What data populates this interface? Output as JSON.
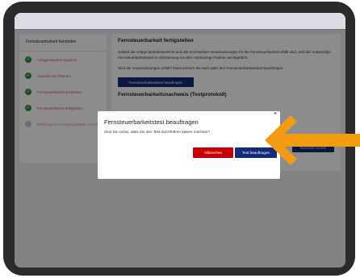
{
  "sidebar": {
    "title": "Fernsteuerbarkeit herstellen",
    "items": [
      {
        "label": "Anlagenstandort angeben",
        "status": "done"
      },
      {
        "label": "Auswahl des Partners",
        "status": "done"
      },
      {
        "label": "Fernsteuerbarkeit bestimmen",
        "status": "done"
      },
      {
        "label": "Fernsteuerbarkeit fertigstellen",
        "status": "done"
      },
      {
        "label": "Erklärung zur Fernsteuerbarkeit einreichen",
        "status": "pending"
      }
    ]
  },
  "panel": {
    "title": "Fernsteuerbarkeit fertigstellen",
    "text": "Sobald die Anlage betriebsbereit ist und alle technischen Voraussetzungen für die Fernsteuerbarkeit erfüllt sind, wird der notwendige Fernsteuerbarkeitstest in Abstimmung mit dem Anbindungs-Partner durchgeführt.",
    "text2": "Sind die Voraussetzungen erfüllt? Dann können Sie auch aktiv den Fernsteuerbarkeitstest beauftragen.",
    "order_button": "Fernsteuerbarkeitstest beauftragen",
    "protocol_title": "Fernsteuerbarkeitsnachweis (Testprotokoll)",
    "next_button": "Nächster Schritt"
  },
  "modal": {
    "title": "Fernsteuerbarkeitstest beauftragen",
    "text": "Sind Sie sicher, dass Sie den Test durchführen lassen möchten?",
    "close": "×",
    "cancel_button": "Abbrechen",
    "confirm_button": "Test beauftragen"
  },
  "colors": {
    "primary": "#142b7a",
    "danger": "#c80000",
    "success": "#2f8f46",
    "highlight_arrow": "#f39c12"
  },
  "icons": {
    "done": "checkmark-icon",
    "pending": "circle-icon",
    "arrow": "arrow-left-icon"
  }
}
